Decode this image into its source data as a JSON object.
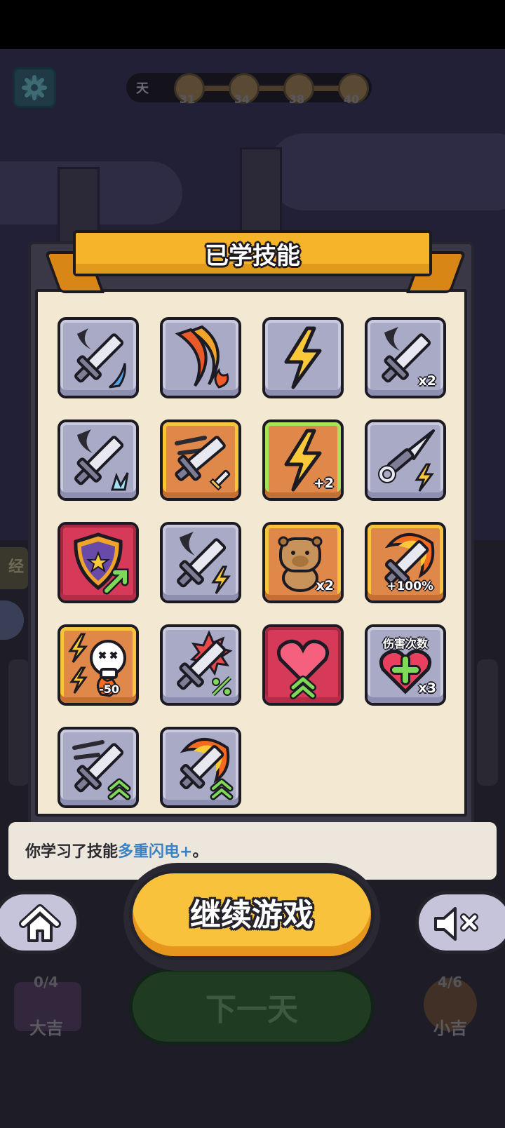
{
  "hud": {
    "day_label": "天",
    "milestones": [
      "31",
      "34",
      "38",
      "40"
    ]
  },
  "background": {
    "side_left_label": "经"
  },
  "modal": {
    "title": "已学技能",
    "skills": [
      {
        "name": "sword-wave-ice-icon",
        "style": "gray",
        "badge": ""
      },
      {
        "name": "fire-crescent-icon",
        "style": "gray",
        "badge": ""
      },
      {
        "name": "lightning-icon",
        "style": "gray",
        "badge": ""
      },
      {
        "name": "sword-slash-double-icon",
        "style": "gray",
        "badge": "x2"
      },
      {
        "name": "sword-ice-burst-icon",
        "style": "gray",
        "badge": ""
      },
      {
        "name": "sword-rush-icon",
        "style": "orange",
        "badge": ""
      },
      {
        "name": "lightning-plus-icon",
        "style": "green",
        "badge": "+2"
      },
      {
        "name": "kunai-lightning-icon",
        "style": "gray",
        "badge": ""
      },
      {
        "name": "shield-up-icon",
        "style": "red",
        "badge": ""
      },
      {
        "name": "sword-lightning-icon",
        "style": "gray",
        "badge": ""
      },
      {
        "name": "capybara-icon",
        "style": "orange",
        "badge": "x2"
      },
      {
        "name": "fire-sword-icon",
        "style": "orange",
        "badge": "+100%"
      },
      {
        "name": "skull-lightning-icon",
        "style": "orange",
        "badge": "-50"
      },
      {
        "name": "sword-crit-percent-icon",
        "style": "gray",
        "badge": ""
      },
      {
        "name": "heart-up-icon",
        "style": "red",
        "badge": ""
      },
      {
        "name": "heart-plus-icon",
        "style": "gray",
        "badge": "x3",
        "top_label": "伤害次数"
      },
      {
        "name": "sword-speed-up-icon",
        "style": "gray",
        "badge": ""
      },
      {
        "name": "fire-sword-up-icon",
        "style": "gray",
        "badge": ""
      }
    ]
  },
  "message": {
    "prefix": "你学习了技能",
    "highlight": "多重闪电+",
    "suffix": "。"
  },
  "buttons": {
    "continue": "继续游戏",
    "next_day": "下一天",
    "home_icon": "home-icon",
    "mute_icon": "mute-icon"
  },
  "bottom": {
    "left_count": "0/4",
    "left_name": "大吉",
    "right_count": "4/6",
    "right_name": "小吉"
  },
  "colors": {
    "panel_bg": "#f3e8d2",
    "banner": "#f5b42a",
    "continue": "#f9c23c",
    "highlight": "#3b82c4"
  }
}
